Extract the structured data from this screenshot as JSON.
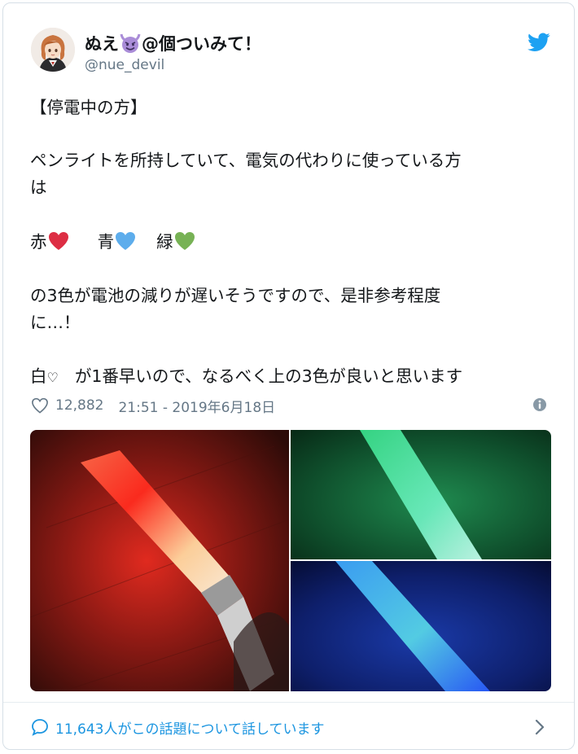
{
  "tweet": {
    "display_name_before": "ぬえ",
    "display_name_after": "@個ついみて！",
    "handle": "@nue_devil",
    "lines": [
      "【停電中の方】",
      "ペンライトを所持していて、電気の代わりに使っている方",
      "は",
      "の3色が電池の減りが遅いそうですので、是非参考程度",
      "に…！",
      "が1番早いので、なるべく上の3色が良いと思います"
    ],
    "colors_line": {
      "red_label": "赤",
      "blue_label": "青",
      "green_label": "緑"
    },
    "white_label": "白",
    "white_heart": "♡",
    "likes": "12,882",
    "timestamp": "21:51 - 2019年6月18日",
    "conversation": "11,643人がこの話題について話しています"
  },
  "icons": {
    "emoji": "smiling-devil-emoji",
    "brand": "twitter-bird-icon",
    "like": "heart-outline-icon",
    "info": "info-icon",
    "reply": "speech-bubble-icon",
    "chevron": "chevron-right-icon"
  },
  "theme": {
    "brand_blue": "#1da1f2",
    "link_blue": "#1b95e0",
    "muted_gray": "#657786",
    "heart_red": "#dd2e44",
    "heart_blue": "#5dadec",
    "heart_green": "#77b255",
    "devil_purple": "#aa8dd8"
  }
}
